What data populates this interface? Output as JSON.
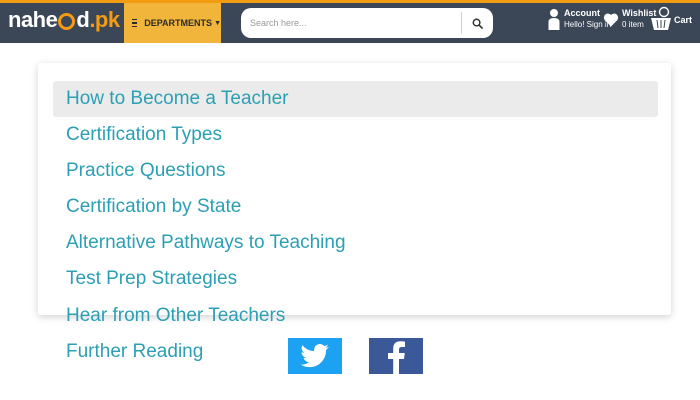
{
  "header": {
    "logo_left": "nahe",
    "logo_right": "d",
    "logo_domain": ".pk",
    "departments_label": "DEPARTMENTS",
    "search_placeholder": "Search here...",
    "account_title": "Account",
    "account_sub": "Hello! Sign in",
    "wishlist_title": "Wishlist",
    "wishlist_sub": "0 item",
    "cart_label": "Cart"
  },
  "menu": {
    "items": [
      "How to Become a Teacher",
      "Certification Types",
      "Practice Questions",
      "Certification by State",
      "Alternative Pathways to Teaching",
      "Test Prep Strategies",
      "Hear from Other Teachers",
      "Further Reading"
    ]
  },
  "social": [
    "twitter-icon",
    "facebook-icon"
  ],
  "colors": {
    "header_bg": "#3b4757",
    "accent": "#f0b53a",
    "link": "#2b9fb4",
    "twitter": "#1da1f2",
    "facebook": "#3b5998"
  }
}
